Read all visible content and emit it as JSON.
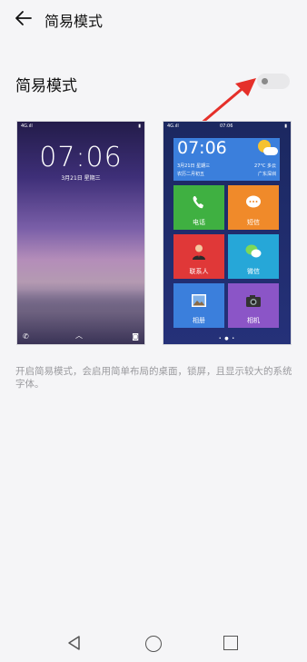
{
  "header": {
    "title": "简易模式"
  },
  "setting": {
    "label": "简易模式",
    "toggle_on": false
  },
  "lock_preview": {
    "status_left": "4G.ıll",
    "status_right": "▮",
    "time": "07:06",
    "date": "3月21日 星期三"
  },
  "simple_preview": {
    "status_left": "4G.ıll",
    "status_center": "07:06",
    "weather": {
      "time": "07:06",
      "date": "3月21日 星期三",
      "lunar": "农历二月初五",
      "temp": "27°C 多云",
      "city": "广东深圳"
    },
    "tiles": [
      {
        "label": "电话",
        "color": "#3fb041",
        "icon": "phone-icon"
      },
      {
        "label": "短信",
        "color": "#f08a2a",
        "icon": "message-icon"
      },
      {
        "label": "联系人",
        "color": "#e03838",
        "icon": "contact-icon"
      },
      {
        "label": "微信",
        "color": "#26a7d8",
        "icon": "wechat-icon"
      },
      {
        "label": "相册",
        "color": "#3b7fdc",
        "icon": "gallery-icon"
      },
      {
        "label": "相机",
        "color": "#8b55c7",
        "icon": "camera-icon"
      }
    ],
    "page_dots": "• ● •"
  },
  "description": "开启简易模式，会启用简单布局的桌面，锁屏，且显示较大的系统字体。",
  "colors": {
    "background": "#f5f5f7",
    "arrow": "#e5302a",
    "text_secondary": "#9a9a9e"
  }
}
